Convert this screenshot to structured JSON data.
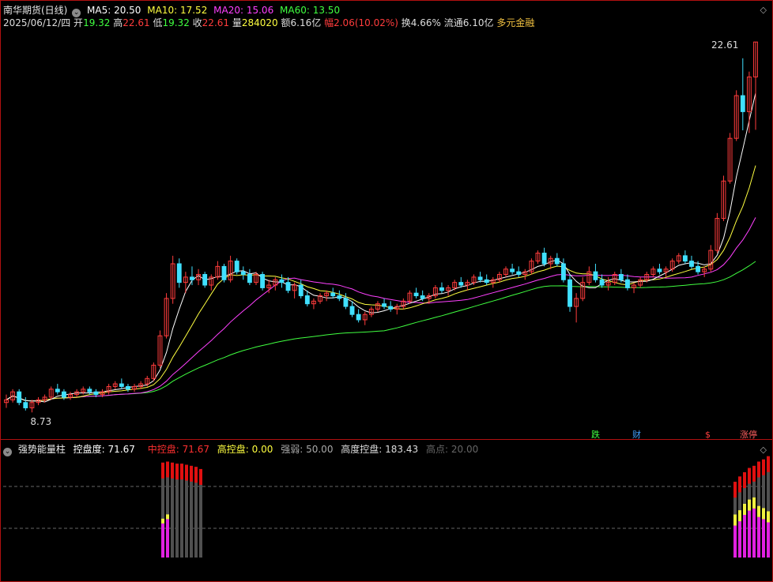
{
  "header": {
    "title": "南华期货(日线)",
    "ma": [
      {
        "label": "MA5: 20.50",
        "color": "#ffffff"
      },
      {
        "label": "MA10: 17.52",
        "color": "#ffff40"
      },
      {
        "label": "MA20: 15.06",
        "color": "#ff40ff"
      },
      {
        "label": "MA60: 13.50",
        "color": "#40ff40"
      }
    ]
  },
  "quote": {
    "date": "2025/06/12/四",
    "open_label": "开",
    "open": "19.32",
    "high_label": "高",
    "high": "22.61",
    "low_label": "低",
    "low": "19.32",
    "close_label": "收",
    "close": "22.61",
    "vol_label": "量",
    "vol": "284020",
    "amt_label": "额",
    "amt": "6.16亿",
    "chg_label": "幅",
    "chg": "2.06(10.02%)",
    "turn_label": "换",
    "turn": "4.66%",
    "float_label": "流通",
    "float": "6.10亿",
    "concept": "多元金融"
  },
  "price_labels": {
    "max": "22.61",
    "min": "8.73"
  },
  "event_markers": [
    "跌",
    "财",
    "$",
    "涨停"
  ],
  "indicator": {
    "name": "强势能量柱",
    "items": [
      {
        "label": "控盘度:",
        "value": "71.67",
        "color": "#ffffff"
      },
      {
        "label": "中控盘:",
        "value": "71.67",
        "color": "#ff3030"
      },
      {
        "label": "高控盘:",
        "value": "0.00",
        "color": "#ffff40"
      },
      {
        "label": "强弱:",
        "value": "50.00",
        "color": "#aaaaaa"
      },
      {
        "label": "高度控盘:",
        "value": "183.43",
        "color": "#dddddd"
      },
      {
        "label": "高点:",
        "value": "20.00",
        "color": "#666666"
      }
    ]
  },
  "colors": {
    "up": "#ff3c3c",
    "down": "#40e0ff",
    "ma5": "#ffffff",
    "ma10": "#ffff40",
    "ma20": "#ff40ff",
    "ma60": "#40ff40",
    "bar_red": "#e01010",
    "bar_gray": "#505050",
    "bar_magenta": "#e020e0",
    "bar_yellow": "#f0f040"
  },
  "chart_data": {
    "type": "candlestick",
    "ylim": [
      8.5,
      23.0
    ],
    "candles": [
      [
        9.1,
        9.4,
        8.9,
        9.2
      ],
      [
        9.2,
        9.6,
        9.1,
        9.5
      ],
      [
        9.5,
        9.6,
        9.0,
        9.1
      ],
      [
        9.1,
        9.3,
        8.8,
        8.9
      ],
      [
        8.9,
        9.2,
        8.73,
        9.1
      ],
      [
        9.1,
        9.3,
        9.0,
        9.2
      ],
      [
        9.2,
        9.4,
        9.1,
        9.3
      ],
      [
        9.3,
        9.7,
        9.2,
        9.6
      ],
      [
        9.6,
        9.8,
        9.4,
        9.5
      ],
      [
        9.5,
        9.6,
        9.2,
        9.3
      ],
      [
        9.3,
        9.5,
        9.2,
        9.4
      ],
      [
        9.4,
        9.6,
        9.3,
        9.5
      ],
      [
        9.5,
        9.7,
        9.4,
        9.6
      ],
      [
        9.6,
        9.7,
        9.4,
        9.5
      ],
      [
        9.5,
        9.6,
        9.3,
        9.4
      ],
      [
        9.4,
        9.6,
        9.3,
        9.5
      ],
      [
        9.5,
        9.8,
        9.4,
        9.7
      ],
      [
        9.7,
        9.9,
        9.6,
        9.8
      ],
      [
        9.8,
        10.0,
        9.6,
        9.7
      ],
      [
        9.7,
        9.8,
        9.5,
        9.6
      ],
      [
        9.6,
        9.8,
        9.5,
        9.7
      ],
      [
        9.7,
        9.9,
        9.6,
        9.8
      ],
      [
        9.8,
        10.1,
        9.7,
        10.0
      ],
      [
        10.0,
        10.6,
        9.9,
        10.5
      ],
      [
        10.5,
        11.8,
        10.4,
        11.6
      ],
      [
        11.6,
        13.2,
        11.5,
        13.0
      ],
      [
        13.0,
        14.6,
        12.8,
        14.3
      ],
      [
        14.3,
        14.5,
        13.4,
        13.6
      ],
      [
        13.6,
        14.0,
        13.2,
        13.8
      ],
      [
        13.8,
        14.2,
        13.5,
        13.7
      ],
      [
        13.7,
        14.1,
        13.5,
        13.9
      ],
      [
        13.9,
        14.0,
        13.4,
        13.5
      ],
      [
        13.5,
        13.9,
        13.3,
        13.8
      ],
      [
        13.8,
        14.4,
        13.7,
        14.2
      ],
      [
        14.2,
        14.3,
        13.6,
        13.7
      ],
      [
        13.7,
        14.6,
        13.6,
        14.4
      ],
      [
        14.4,
        14.5,
        13.9,
        14.0
      ],
      [
        14.0,
        14.2,
        13.7,
        13.9
      ],
      [
        13.9,
        14.1,
        13.5,
        13.6
      ],
      [
        13.6,
        14.0,
        13.5,
        13.9
      ],
      [
        13.9,
        14.0,
        13.3,
        13.4
      ],
      [
        13.4,
        13.7,
        13.2,
        13.5
      ],
      [
        13.5,
        13.8,
        13.3,
        13.7
      ],
      [
        13.7,
        13.9,
        13.4,
        13.6
      ],
      [
        13.6,
        13.8,
        13.2,
        13.3
      ],
      [
        13.3,
        13.6,
        13.0,
        13.5
      ],
      [
        13.5,
        13.7,
        13.0,
        13.1
      ],
      [
        13.1,
        13.3,
        12.7,
        12.8
      ],
      [
        12.8,
        13.0,
        12.6,
        12.9
      ],
      [
        12.9,
        13.2,
        12.8,
        13.1
      ],
      [
        13.1,
        13.3,
        12.9,
        13.2
      ],
      [
        13.2,
        13.4,
        13.0,
        13.1
      ],
      [
        13.1,
        13.3,
        12.9,
        13.0
      ],
      [
        13.0,
        13.2,
        12.6,
        12.7
      ],
      [
        12.7,
        12.9,
        12.3,
        12.4
      ],
      [
        12.4,
        12.6,
        12.1,
        12.2
      ],
      [
        12.2,
        12.5,
        12.0,
        12.4
      ],
      [
        12.4,
        12.7,
        12.3,
        12.6
      ],
      [
        12.6,
        12.9,
        12.5,
        12.8
      ],
      [
        12.8,
        13.0,
        12.6,
        12.7
      ],
      [
        12.7,
        12.9,
        12.5,
        12.6
      ],
      [
        12.6,
        12.8,
        12.4,
        12.7
      ],
      [
        12.7,
        13.0,
        12.6,
        12.9
      ],
      [
        12.9,
        13.3,
        12.8,
        13.2
      ],
      [
        13.2,
        13.4,
        13.0,
        13.1
      ],
      [
        13.1,
        13.3,
        12.9,
        13.0
      ],
      [
        13.0,
        13.2,
        12.8,
        13.1
      ],
      [
        13.1,
        13.5,
        13.0,
        13.4
      ],
      [
        13.4,
        13.6,
        13.2,
        13.3
      ],
      [
        13.3,
        13.5,
        13.1,
        13.4
      ],
      [
        13.4,
        13.7,
        13.3,
        13.6
      ],
      [
        13.6,
        13.8,
        13.4,
        13.5
      ],
      [
        13.5,
        13.7,
        13.3,
        13.6
      ],
      [
        13.6,
        13.9,
        13.5,
        13.8
      ],
      [
        13.8,
        14.0,
        13.6,
        13.7
      ],
      [
        13.7,
        13.9,
        13.5,
        13.6
      ],
      [
        13.6,
        13.8,
        13.4,
        13.7
      ],
      [
        13.7,
        14.0,
        13.6,
        13.9
      ],
      [
        13.9,
        14.2,
        13.8,
        14.1
      ],
      [
        14.1,
        14.3,
        13.9,
        14.0
      ],
      [
        14.0,
        14.2,
        13.8,
        13.9
      ],
      [
        13.9,
        14.1,
        13.7,
        14.0
      ],
      [
        14.0,
        14.5,
        13.9,
        14.4
      ],
      [
        14.4,
        14.8,
        14.3,
        14.7
      ],
      [
        14.7,
        14.9,
        14.2,
        14.3
      ],
      [
        14.3,
        14.6,
        14.1,
        14.5
      ],
      [
        14.5,
        14.7,
        14.2,
        14.3
      ],
      [
        14.3,
        14.5,
        13.6,
        13.7
      ],
      [
        13.7,
        13.9,
        12.5,
        12.7
      ],
      [
        12.7,
        13.2,
        12.1,
        13.0
      ],
      [
        13.0,
        13.8,
        12.9,
        13.6
      ],
      [
        13.6,
        14.2,
        13.5,
        14.0
      ],
      [
        14.0,
        14.3,
        13.6,
        13.7
      ],
      [
        13.7,
        13.9,
        13.4,
        13.5
      ],
      [
        13.5,
        13.8,
        13.3,
        13.6
      ],
      [
        13.6,
        14.0,
        13.5,
        13.9
      ],
      [
        13.9,
        14.1,
        13.6,
        13.7
      ],
      [
        13.7,
        13.9,
        13.3,
        13.4
      ],
      [
        13.4,
        13.6,
        13.2,
        13.5
      ],
      [
        13.5,
        13.8,
        13.4,
        13.7
      ],
      [
        13.7,
        14.0,
        13.6,
        13.9
      ],
      [
        13.9,
        14.2,
        13.8,
        14.1
      ],
      [
        14.1,
        14.3,
        13.9,
        14.0
      ],
      [
        14.0,
        14.2,
        13.8,
        14.1
      ],
      [
        14.1,
        14.5,
        14.0,
        14.4
      ],
      [
        14.4,
        14.7,
        14.3,
        14.6
      ],
      [
        14.6,
        14.8,
        14.3,
        14.4
      ],
      [
        14.4,
        14.6,
        14.1,
        14.2
      ],
      [
        14.2,
        14.4,
        13.9,
        14.0
      ],
      [
        14.0,
        14.2,
        13.8,
        14.1
      ],
      [
        14.1,
        15.0,
        14.0,
        14.8
      ],
      [
        14.8,
        16.2,
        14.7,
        16.0
      ],
      [
        16.0,
        17.6,
        15.9,
        17.4
      ],
      [
        17.4,
        19.2,
        17.3,
        19.0
      ],
      [
        19.0,
        20.8,
        18.9,
        20.6
      ],
      [
        20.6,
        22.0,
        19.3,
        20.0
      ],
      [
        20.0,
        21.5,
        19.2,
        21.3
      ],
      [
        21.3,
        22.61,
        19.32,
        22.61
      ]
    ],
    "indicator_bars": {
      "groups": [
        {
          "count": 9,
          "red": [
            89,
            90,
            89,
            88,
            88,
            87,
            86,
            85,
            83
          ],
          "magenta": [
            32,
            36,
            0,
            0,
            0,
            0,
            0,
            0,
            0
          ]
        },
        {
          "count": 8,
          "red": [
            71,
            76,
            80,
            84,
            86,
            90,
            92,
            95
          ],
          "magenta": [
            30,
            34,
            40,
            44,
            46,
            38,
            36,
            33
          ]
        }
      ]
    }
  }
}
